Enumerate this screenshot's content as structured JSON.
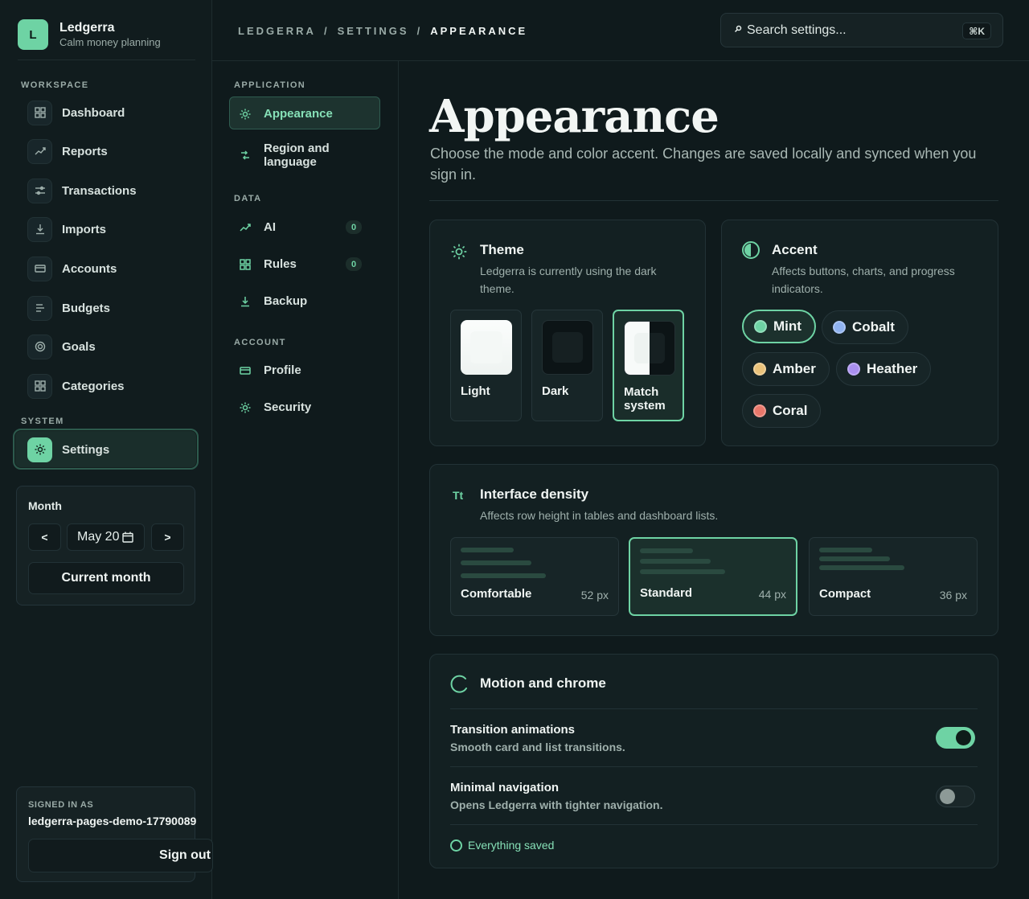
{
  "brand": {
    "logo_letter": "L",
    "name": "Ledgerra",
    "tagline": "Calm money planning"
  },
  "sidebar": {
    "workspace_label": "WORKSPACE",
    "system_label": "SYSTEM",
    "items": [
      {
        "label": "Dashboard",
        "icon": "dashboard-icon"
      },
      {
        "label": "Reports",
        "icon": "trend-icon"
      },
      {
        "label": "Transactions",
        "icon": "sliders-icon"
      },
      {
        "label": "Imports",
        "icon": "download-icon"
      },
      {
        "label": "Accounts",
        "icon": "card-icon"
      },
      {
        "label": "Budgets",
        "icon": "budget-icon"
      },
      {
        "label": "Goals",
        "icon": "target-icon"
      },
      {
        "label": "Categories",
        "icon": "grid-icon"
      }
    ],
    "settings": {
      "label": "Settings",
      "icon": "gear-icon"
    },
    "month": {
      "label": "Month",
      "prev": "<",
      "next": ">",
      "value": "May 20",
      "current_button": "Current month"
    },
    "user": {
      "signed_in_label": "SIGNED IN AS",
      "username": "ledgerra-pages-demo-17790089",
      "sign_out": "Sign out"
    }
  },
  "topbar": {
    "breadcrumb": [
      "LEDGERRA",
      "SETTINGS",
      "APPEARANCE"
    ],
    "separator": "/",
    "search_placeholder": "Search settings...",
    "search_shortcut": "⌘K"
  },
  "subnav": {
    "application_label": "APPLICATION",
    "data_label": "DATA",
    "account_label": "ACCOUNT",
    "appearance": "Appearance",
    "region": "Region and language",
    "ai": {
      "label": "AI",
      "count": "0"
    },
    "rules": {
      "label": "Rules",
      "count": "0"
    },
    "backup": "Backup",
    "profile": "Profile",
    "security": "Security"
  },
  "main": {
    "title": "Appearance",
    "description": "Choose the mode and color accent. Changes are saved locally and synced when you sign in.",
    "theme": {
      "title": "Theme",
      "description": "Ledgerra is currently using the dark theme.",
      "options": [
        "Light",
        "Dark",
        "Match system"
      ],
      "selected": "Match system"
    },
    "accent": {
      "title": "Accent",
      "description": "Affects buttons, charts, and progress indicators.",
      "options": [
        {
          "name": "Mint",
          "color": "#6ed3a4"
        },
        {
          "name": "Cobalt",
          "color": "#8fb2f0"
        },
        {
          "name": "Amber",
          "color": "#eac27a"
        },
        {
          "name": "Heather",
          "color": "#a98ff0"
        },
        {
          "name": "Coral",
          "color": "#e8776a"
        }
      ],
      "selected": "Mint"
    },
    "density": {
      "icon_text": "Tt",
      "title": "Interface density",
      "description": "Affects row height in tables and dashboard lists.",
      "options": [
        {
          "name": "Comfortable",
          "size": "52 px"
        },
        {
          "name": "Standard",
          "size": "44 px"
        },
        {
          "name": "Compact",
          "size": "36 px"
        }
      ],
      "selected": "Standard"
    },
    "motion": {
      "title": "Motion and chrome",
      "rows": [
        {
          "title": "Transition animations",
          "subtitle": "Smooth card and list transitions.",
          "enabled": true
        },
        {
          "title": "Minimal navigation",
          "subtitle": "Opens Ledgerra with tighter navigation.",
          "enabled": false
        }
      ],
      "status": "Everything saved"
    }
  },
  "colors": {
    "accent": "#6ed3a4",
    "background": "#0f1a1c"
  }
}
